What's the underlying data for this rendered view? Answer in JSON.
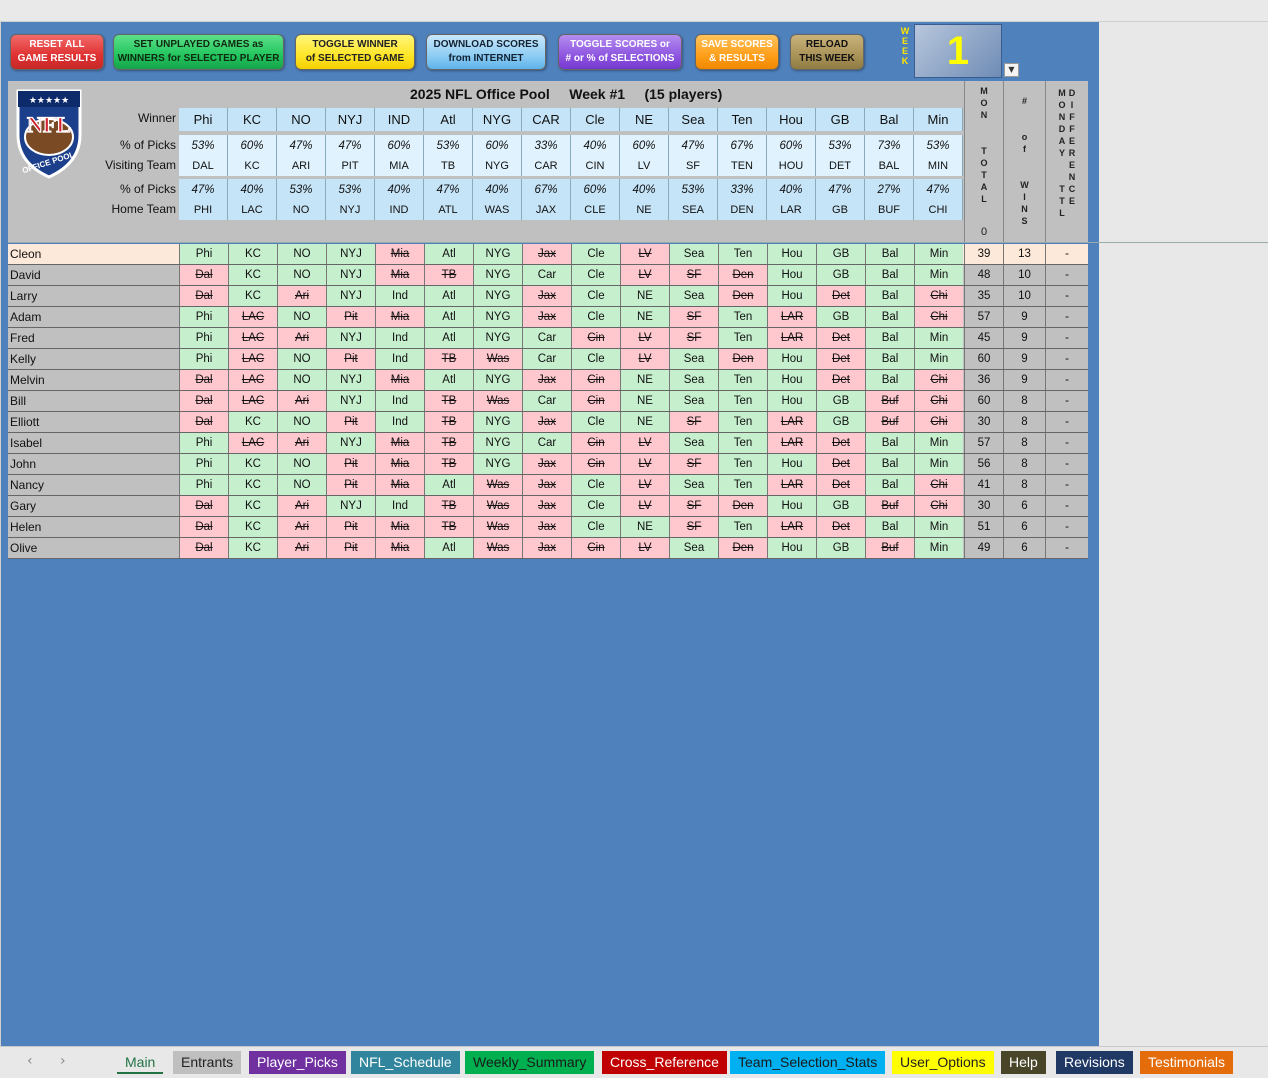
{
  "buttons": [
    {
      "label": "RESET ALL\nGAME RESULTS",
      "style": "b-red"
    },
    {
      "label": "SET UNPLAYED GAMES as\nWINNERS for SELECTED PLAYER",
      "style": "b-green"
    },
    {
      "label": "TOGGLE WINNER\nof SELECTED GAME",
      "style": "b-yellow"
    },
    {
      "label": "DOWNLOAD SCORES\nfrom INTERNET",
      "style": "b-blue"
    },
    {
      "label": "TOGGLE SCORES or\n# or % of SELECTIONS",
      "style": "b-purple"
    },
    {
      "label": "SAVE SCORES\n& RESULTS",
      "style": "b-orange"
    },
    {
      "label": "RELOAD\nTHIS WEEK",
      "style": "b-olive"
    }
  ],
  "week": {
    "label": "WEEK",
    "value": "1"
  },
  "logo": {
    "text": "NFL",
    "ring_text": "OFFICE POOL"
  },
  "title": "2025 NFL Office Pool     Week #1     (15 players)",
  "row_labels": {
    "winner": "Winner",
    "pct_visit": "% of Picks",
    "visiting": "Visiting Team",
    "pct_home": "% of Picks",
    "home": "Home Team"
  },
  "games": [
    {
      "winner": "Phi",
      "vpct": "53%",
      "visit": "DAL",
      "hpct": "47%",
      "home": "PHI"
    },
    {
      "winner": "KC",
      "vpct": "60%",
      "visit": "KC",
      "hpct": "40%",
      "home": "LAC"
    },
    {
      "winner": "NO",
      "vpct": "47%",
      "visit": "ARI",
      "hpct": "53%",
      "home": "NO"
    },
    {
      "winner": "NYJ",
      "vpct": "47%",
      "visit": "PIT",
      "hpct": "53%",
      "home": "NYJ"
    },
    {
      "winner": "IND",
      "vpct": "60%",
      "visit": "MIA",
      "hpct": "40%",
      "home": "IND"
    },
    {
      "winner": "Atl",
      "vpct": "53%",
      "visit": "TB",
      "hpct": "47%",
      "home": "ATL"
    },
    {
      "winner": "NYG",
      "vpct": "60%",
      "visit": "NYG",
      "hpct": "40%",
      "home": "WAS"
    },
    {
      "winner": "CAR",
      "vpct": "33%",
      "visit": "CAR",
      "hpct": "67%",
      "home": "JAX"
    },
    {
      "winner": "Cle",
      "vpct": "40%",
      "visit": "CIN",
      "hpct": "60%",
      "home": "CLE"
    },
    {
      "winner": "NE",
      "vpct": "60%",
      "visit": "LV",
      "hpct": "40%",
      "home": "NE"
    },
    {
      "winner": "Sea",
      "vpct": "47%",
      "visit": "SF",
      "hpct": "53%",
      "home": "SEA"
    },
    {
      "winner": "Ten",
      "vpct": "67%",
      "visit": "TEN",
      "hpct": "33%",
      "home": "DEN"
    },
    {
      "winner": "Hou",
      "vpct": "60%",
      "visit": "HOU",
      "hpct": "40%",
      "home": "LAR"
    },
    {
      "winner": "GB",
      "vpct": "53%",
      "visit": "DET",
      "hpct": "47%",
      "home": "GB"
    },
    {
      "winner": "Bal",
      "vpct": "73%",
      "visit": "BAL",
      "hpct": "27%",
      "home": "BUF"
    },
    {
      "winner": "Min",
      "vpct": "53%",
      "visit": "MIN",
      "hpct": "47%",
      "home": "CHI"
    }
  ],
  "side_headers": {
    "mon_total": "MON  TOTAL",
    "mon_total_value": "0",
    "wins": "#  of  WINS",
    "monday_ttl": "MONDAY  TTL",
    "difference": "DIFFERENCE"
  },
  "players": [
    {
      "name": "Cleon",
      "picks": [
        "Phi",
        "KC",
        "NO",
        "NYJ",
        "Mia",
        "Atl",
        "NYG",
        "Jax",
        "Cle",
        "LV",
        "Sea",
        "Ten",
        "Hou",
        "GB",
        "Bal",
        "Min"
      ],
      "total": "39",
      "wins": "13",
      "diff": "-"
    },
    {
      "name": "David",
      "picks": [
        "Dal",
        "KC",
        "NO",
        "NYJ",
        "Mia",
        "TB",
        "NYG",
        "Car",
        "Cle",
        "LV",
        "SF",
        "Den",
        "Hou",
        "GB",
        "Bal",
        "Min"
      ],
      "total": "48",
      "wins": "10",
      "diff": "-"
    },
    {
      "name": "Larry",
      "picks": [
        "Dal",
        "KC",
        "Ari",
        "NYJ",
        "Ind",
        "Atl",
        "NYG",
        "Jax",
        "Cle",
        "NE",
        "Sea",
        "Den",
        "Hou",
        "Det",
        "Bal",
        "Chi"
      ],
      "total": "35",
      "wins": "10",
      "diff": "-"
    },
    {
      "name": "Adam",
      "picks": [
        "Phi",
        "LAC",
        "NO",
        "Pit",
        "Mia",
        "Atl",
        "NYG",
        "Jax",
        "Cle",
        "NE",
        "SF",
        "Ten",
        "LAR",
        "GB",
        "Bal",
        "Chi"
      ],
      "total": "57",
      "wins": "9",
      "diff": "-"
    },
    {
      "name": "Fred",
      "picks": [
        "Phi",
        "LAC",
        "Ari",
        "NYJ",
        "Ind",
        "Atl",
        "NYG",
        "Car",
        "Cin",
        "LV",
        "SF",
        "Ten",
        "LAR",
        "Det",
        "Bal",
        "Min"
      ],
      "total": "45",
      "wins": "9",
      "diff": "-"
    },
    {
      "name": "Kelly",
      "picks": [
        "Phi",
        "LAC",
        "NO",
        "Pit",
        "Ind",
        "TB",
        "Was",
        "Car",
        "Cle",
        "LV",
        "Sea",
        "Den",
        "Hou",
        "Det",
        "Bal",
        "Min"
      ],
      "total": "60",
      "wins": "9",
      "diff": "-"
    },
    {
      "name": "Melvin",
      "picks": [
        "Dal",
        "LAC",
        "NO",
        "NYJ",
        "Mia",
        "Atl",
        "NYG",
        "Jax",
        "Cin",
        "NE",
        "Sea",
        "Ten",
        "Hou",
        "Det",
        "Bal",
        "Chi"
      ],
      "total": "36",
      "wins": "9",
      "diff": "-"
    },
    {
      "name": "Bill",
      "picks": [
        "Dal",
        "LAC",
        "Ari",
        "NYJ",
        "Ind",
        "TB",
        "Was",
        "Car",
        "Cin",
        "NE",
        "Sea",
        "Ten",
        "Hou",
        "GB",
        "Buf",
        "Chi"
      ],
      "total": "60",
      "wins": "8",
      "diff": "-"
    },
    {
      "name": "Elliott",
      "picks": [
        "Dal",
        "KC",
        "NO",
        "Pit",
        "Ind",
        "TB",
        "NYG",
        "Jax",
        "Cle",
        "NE",
        "SF",
        "Ten",
        "LAR",
        "GB",
        "Buf",
        "Chi"
      ],
      "total": "30",
      "wins": "8",
      "diff": "-"
    },
    {
      "name": "Isabel",
      "picks": [
        "Phi",
        "LAC",
        "Ari",
        "NYJ",
        "Mia",
        "TB",
        "NYG",
        "Car",
        "Cin",
        "LV",
        "Sea",
        "Ten",
        "LAR",
        "Det",
        "Bal",
        "Min"
      ],
      "total": "57",
      "wins": "8",
      "diff": "-"
    },
    {
      "name": "John",
      "picks": [
        "Phi",
        "KC",
        "NO",
        "Pit",
        "Mia",
        "TB",
        "NYG",
        "Jax",
        "Cin",
        "LV",
        "SF",
        "Ten",
        "Hou",
        "Det",
        "Bal",
        "Min"
      ],
      "total": "56",
      "wins": "8",
      "diff": "-"
    },
    {
      "name": "Nancy",
      "picks": [
        "Phi",
        "KC",
        "NO",
        "Pit",
        "Mia",
        "Atl",
        "Was",
        "Jax",
        "Cle",
        "LV",
        "Sea",
        "Ten",
        "LAR",
        "Det",
        "Bal",
        "Chi"
      ],
      "total": "41",
      "wins": "8",
      "diff": "-"
    },
    {
      "name": "Gary",
      "picks": [
        "Dal",
        "KC",
        "Ari",
        "NYJ",
        "Ind",
        "TB",
        "Was",
        "Jax",
        "Cle",
        "LV",
        "SF",
        "Den",
        "Hou",
        "GB",
        "Buf",
        "Chi"
      ],
      "total": "30",
      "wins": "6",
      "diff": "-"
    },
    {
      "name": "Helen",
      "picks": [
        "Dal",
        "KC",
        "Ari",
        "Pit",
        "Mia",
        "TB",
        "Was",
        "Jax",
        "Cle",
        "NE",
        "SF",
        "Ten",
        "LAR",
        "Det",
        "Bal",
        "Min"
      ],
      "total": "51",
      "wins": "6",
      "diff": "-"
    },
    {
      "name": "Olive",
      "picks": [
        "Dal",
        "KC",
        "Ari",
        "Pit",
        "Mia",
        "Atl",
        "Was",
        "Jax",
        "Cin",
        "LV",
        "Sea",
        "Den",
        "Hou",
        "GB",
        "Buf",
        "Min"
      ],
      "total": "49",
      "wins": "6",
      "diff": "-"
    }
  ],
  "tabs": [
    {
      "label": "Main",
      "bg": "#e8e8e8",
      "fg": "#217346",
      "active": true
    },
    {
      "label": "Entrants",
      "bg": "#bfbfbf",
      "fg": "#222"
    },
    {
      "label": "Player_Picks",
      "bg": "#7030a0",
      "fg": "#ffffff"
    },
    {
      "label": "NFL_Schedule",
      "bg": "#31859c",
      "fg": "#ffffff"
    },
    {
      "label": "Weekly_Summary",
      "bg": "#00b050",
      "fg": "#1a1a1a"
    },
    {
      "label": "Cross_Reference",
      "bg": "#c00000",
      "fg": "#ffffff"
    },
    {
      "label": "Team_Selection_Stats",
      "bg": "#00b0f0",
      "fg": "#1a1a1a"
    },
    {
      "label": "User_Options",
      "bg": "#ffff00",
      "fg": "#222"
    },
    {
      "label": "Help",
      "bg": "#494529",
      "fg": "#ffffff"
    },
    {
      "label": "Revisions",
      "bg": "#1f3864",
      "fg": "#ffffff"
    },
    {
      "label": "Testimonials",
      "bg": "#e46c0a",
      "fg": "#ffffff"
    }
  ]
}
